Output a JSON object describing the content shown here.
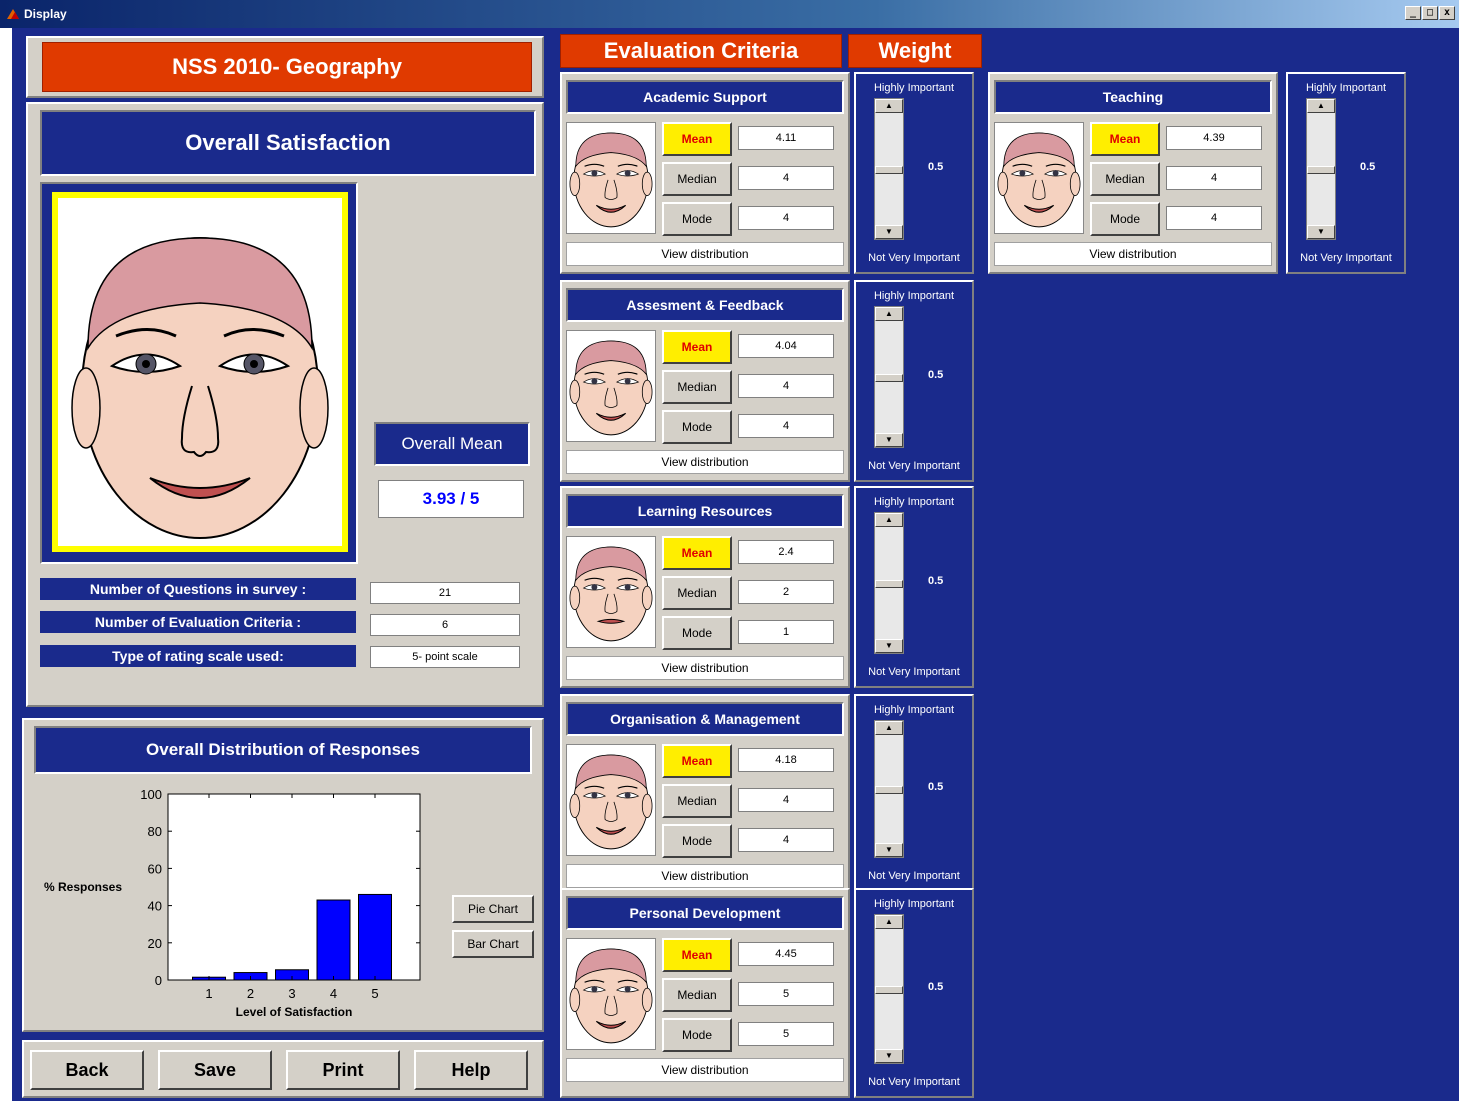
{
  "window": {
    "title": "Display",
    "controls": [
      "_",
      "□",
      "x"
    ]
  },
  "header": {
    "title": "NSS 2010- Geography"
  },
  "overall": {
    "title": "Overall Satisfaction",
    "mean_label": "Overall Mean",
    "mean_value": "3.93 / 5",
    "info": [
      {
        "label": "Number of Questions in survey :",
        "value": "21"
      },
      {
        "label": "Number of Evaluation Criteria :",
        "value": "6"
      },
      {
        "label": "Type of rating scale used:",
        "value": "5- point scale"
      }
    ]
  },
  "distribution": {
    "title": "Overall Distribution of Responses",
    "pie_button": "Pie Chart",
    "bar_button": "Bar Chart"
  },
  "chart_data": {
    "type": "bar",
    "categories": [
      "1",
      "2",
      "3",
      "4",
      "5"
    ],
    "values": [
      1.5,
      4,
      5.5,
      43,
      46
    ],
    "xlabel": "Level of Satisfaction",
    "ylabel": "% Responses",
    "ylim": [
      0,
      100
    ],
    "yticks": [
      "0",
      "20",
      "40",
      "60",
      "80",
      "100"
    ],
    "bar_color": "#0000ff"
  },
  "footer": {
    "back": "Back",
    "save": "Save",
    "print": "Print",
    "help": "Help"
  },
  "criteria_header": {
    "title": "Evaluation Criteria",
    "weight": "Weight"
  },
  "weight_labels": {
    "high": "Highly Important",
    "low": "Not Very Important"
  },
  "stat_labels": {
    "mean": "Mean",
    "median": "Median",
    "mode": "Mode",
    "view": "View distribution"
  },
  "criteria": [
    {
      "name": "Academic Support",
      "mean": "4.11",
      "median": "4",
      "mode": "4",
      "weight": "0.5"
    },
    {
      "name": "Assesment & Feedback",
      "mean": "4.04",
      "median": "4",
      "mode": "4",
      "weight": "0.5"
    },
    {
      "name": "Learning Resources",
      "mean": "2.4",
      "median": "2",
      "mode": "1",
      "weight": "0.5"
    },
    {
      "name": "Organisation & Management",
      "mean": "4.18",
      "median": "4",
      "mode": "4",
      "weight": "0.5"
    },
    {
      "name": "Personal Development",
      "mean": "4.45",
      "median": "5",
      "mode": "5",
      "weight": "0.5"
    },
    {
      "name": "Teaching",
      "mean": "4.39",
      "median": "4",
      "mode": "4",
      "weight": "0.5"
    }
  ],
  "colors": {
    "navy": "#1a2a8c",
    "red": "#e03a00",
    "panel": "#d4d0c8",
    "mean_btn": "#ffee00"
  }
}
